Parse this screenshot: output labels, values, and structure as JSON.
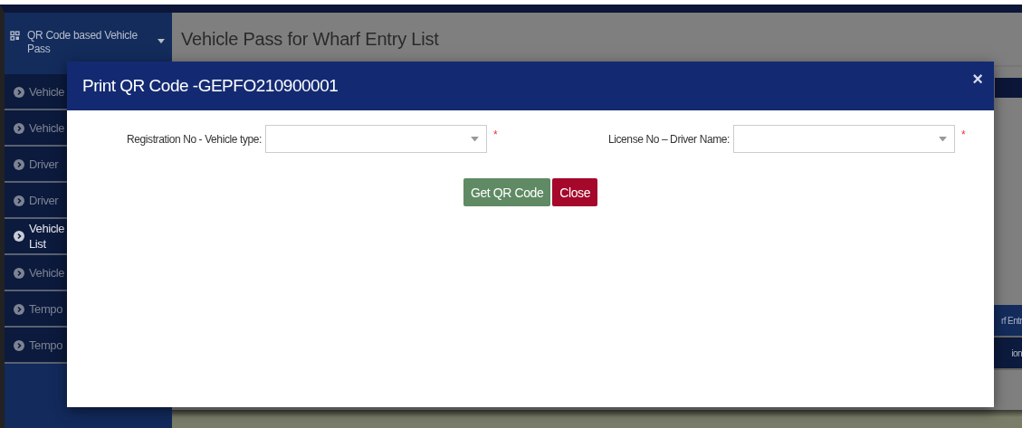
{
  "sidebar": {
    "header": "QR Code based Vehicle Pass",
    "items": [
      {
        "label": "Vehicle",
        "selected": false
      },
      {
        "label": "Vehicle",
        "selected": false
      },
      {
        "label": "Driver",
        "selected": false
      },
      {
        "label": "Driver",
        "selected": false
      },
      {
        "label": "Vehicle List",
        "selected": true
      },
      {
        "label": "Vehicle",
        "selected": false
      },
      {
        "label": "Tempo",
        "selected": false
      },
      {
        "label": "Tempo",
        "selected": false
      }
    ]
  },
  "page": {
    "title": "Vehicle Pass for Wharf Entry List",
    "side_texts": [
      "rf Entr",
      "ion"
    ]
  },
  "modal": {
    "title": "Print QR Code -GEPFO210900001",
    "close": "×",
    "fields": [
      {
        "label": "Registration No - Vehicle type:",
        "required": "*"
      },
      {
        "label": "License No – Driver Name:",
        "required": "*"
      }
    ],
    "buttons": [
      {
        "label": "Get QR Code",
        "kind": "primary"
      },
      {
        "label": "Close",
        "kind": "danger"
      }
    ]
  }
}
